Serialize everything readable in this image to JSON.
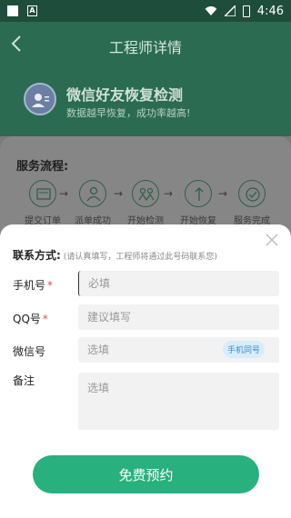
{
  "status_bar": {
    "time": "4:46"
  },
  "header": {
    "title": "工程师详情",
    "promo_title": "微信好友恢复检测",
    "promo_subtitle": "数据越早恢复，成功率越高!"
  },
  "service": {
    "title": "服务流程:",
    "steps": [
      {
        "label": "提交订单",
        "icon": "order-icon"
      },
      {
        "label": "派单成功",
        "icon": "person-icon"
      },
      {
        "label": "开始检测",
        "icon": "people-icon"
      },
      {
        "label": "开始恢复",
        "icon": "recover-icon"
      },
      {
        "label": "服务完成",
        "icon": "check-icon"
      }
    ]
  },
  "form": {
    "contact_label": "联系方式:",
    "contact_hint": "(请认真填写，工程师将通过此号码联系您)",
    "phone": {
      "label": "手机号",
      "required": "*",
      "placeholder": "必填"
    },
    "qq": {
      "label": "QQ号",
      "required": "*",
      "placeholder": "建议填写"
    },
    "wechat": {
      "label": "微信号",
      "placeholder": "选填",
      "tag": "手机同号"
    },
    "note": {
      "label": "备注",
      "placeholder": "选填"
    },
    "submit_label": "免费预约"
  }
}
